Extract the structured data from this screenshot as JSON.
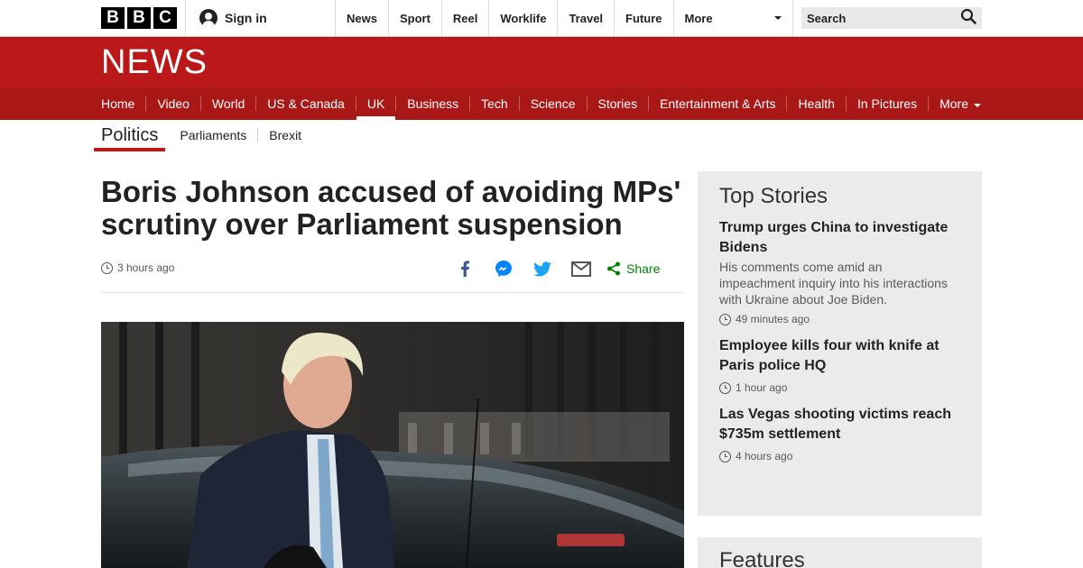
{
  "topbar": {
    "logo_letters": [
      "B",
      "B",
      "C"
    ],
    "signin_label": "Sign in",
    "nav": [
      "News",
      "Sport",
      "Reel",
      "Worklife",
      "Travel",
      "Future"
    ],
    "more_label": "More",
    "search_placeholder": "Search"
  },
  "masthead": {
    "title": "NEWS"
  },
  "sectionnav": {
    "items": [
      "Home",
      "Video",
      "World",
      "US & Canada",
      "UK",
      "Business",
      "Tech",
      "Science",
      "Stories",
      "Entertainment & Arts",
      "Health",
      "In Pictures"
    ],
    "active": "UK",
    "more_label": "More"
  },
  "subnav": {
    "current": "Politics",
    "items": [
      "Parliaments",
      "Brexit"
    ]
  },
  "article": {
    "headline": "Boris Johnson accused of avoiding MPs' scrutiny over Parliament suspension",
    "timestamp": "3 hours ago",
    "share_label": "Share"
  },
  "sidebar": {
    "top_stories_title": "Top Stories",
    "stories": [
      {
        "title": "Trump urges China to investigate Bidens",
        "summary": "His comments come amid an impeachment inquiry into his interactions with Ukraine about Joe Biden.",
        "ago": "49 minutes ago"
      },
      {
        "title": "Employee kills four with knife at Paris police HQ",
        "summary": "",
        "ago": "1 hour ago"
      },
      {
        "title": "Las Vegas shooting victims reach $735m settlement",
        "summary": "",
        "ago": "4 hours ago"
      }
    ],
    "features_title": "Features"
  },
  "colors": {
    "brand_red": "#bb1919",
    "nav_red": "#a91717",
    "share_green": "#008000",
    "facebook": "#3b5998",
    "messenger": "#0084ff",
    "twitter": "#1da1f2"
  }
}
